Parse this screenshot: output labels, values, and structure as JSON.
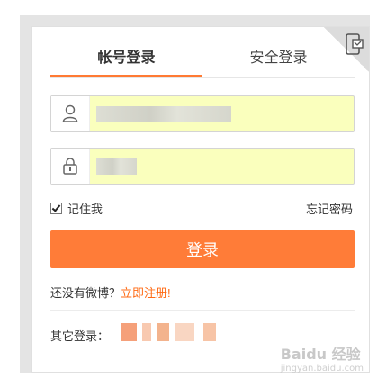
{
  "tabs": [
    {
      "label": "帐号登录",
      "active": true
    },
    {
      "label": "安全登录",
      "active": false
    }
  ],
  "corner": {
    "icon": "qrcode-phone-icon"
  },
  "username": {
    "icon": "user-icon",
    "value_masked": "blurred"
  },
  "password": {
    "icon": "lock-icon",
    "value_masked": "blurred"
  },
  "remember": {
    "label": "记住我",
    "checked": true
  },
  "forgot": {
    "label": "忘记密码"
  },
  "login_button": {
    "label": "登录"
  },
  "register": {
    "prefix": "还没有微博？",
    "link": "立即注册!"
  },
  "other": {
    "label": "其它登录："
  },
  "watermark": {
    "text": "Baidu 经验",
    "sub": "jingyan.baidu.com"
  },
  "colors": {
    "accent": "#ff7c38",
    "link": "#ff6a13",
    "autofill": "#faffbd"
  }
}
